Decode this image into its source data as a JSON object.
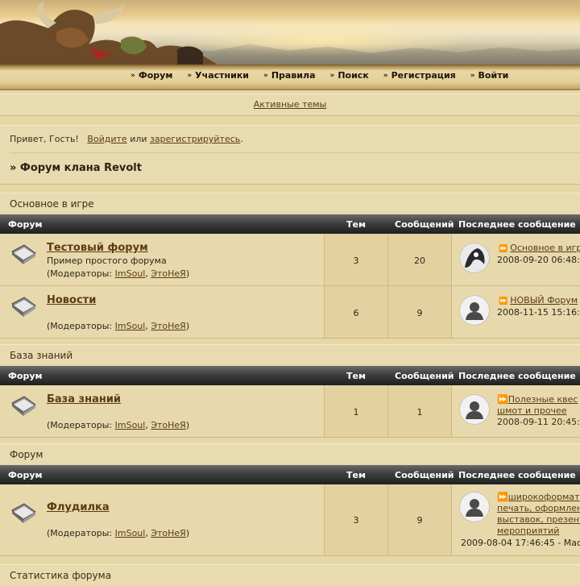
{
  "nav": {
    "items": [
      "Форум",
      "Участники",
      "Правила",
      "Поиск",
      "Регистрация",
      "Войти"
    ]
  },
  "active_topics": "Активные темы",
  "greeting": {
    "prefix": "Привет, Гость!",
    "login": "Войдите",
    "or": "или",
    "register": "зарегистрируйтесь",
    "suffix": "."
  },
  "breadcrumb": "» Форум клана Revolt",
  "table_headers": {
    "forum": "Форум",
    "topics": "Тем",
    "posts": "Сообщений",
    "last": "Последнее сообщение"
  },
  "mods": {
    "prefix": "(Модераторы:",
    "mod1": "ImSoul",
    "comma": ",",
    "mod2": "ЭтоНеЯ",
    "suffix": ")"
  },
  "categories": [
    {
      "name": "Основное в игре",
      "forums": [
        {
          "title": "Тестовый форум",
          "description": "Пример простого форума",
          "topics": "3",
          "posts": "20",
          "last_title": "Основное в игре",
          "last_date": "2008-09-20 06:48:"
        },
        {
          "title": "Новости",
          "description": "",
          "topics": "6",
          "posts": "9",
          "last_title": "НОВЫЙ Форум",
          "last_date": "2008-11-15 15:16:"
        }
      ]
    },
    {
      "name": "База знаний",
      "forums": [
        {
          "title": "База знаний",
          "description": "",
          "topics": "1",
          "posts": "1",
          "last_title_line1": "Полезные квес",
          "last_title_line2": "шмот и прочее",
          "last_date": "2008-09-11 20:45:"
        }
      ]
    },
    {
      "name": "Форум",
      "forums": [
        {
          "title": "Флудилка",
          "description": "",
          "topics": "3",
          "posts": "9",
          "last_title_line1": "широкоформат",
          "last_title_line2": "печать, оформлен",
          "last_title_line3": "выставок, презент",
          "last_title_line4": "мероприятий",
          "last_date": "2009-08-04 17:46:45 - Mac"
        }
      ]
    }
  ],
  "stats_title": "Статистика форума",
  "colors": {
    "link": "#5a3c10",
    "background": "#e6d7a6",
    "header_dark": "#1f1f1f"
  }
}
